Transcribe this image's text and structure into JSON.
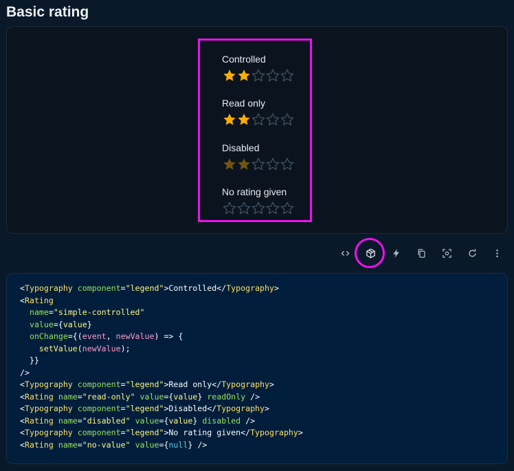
{
  "page": {
    "title": "Basic rating"
  },
  "ratings": [
    {
      "legend": "Controlled",
      "value": 2,
      "max": 5,
      "state": "active"
    },
    {
      "legend": "Read only",
      "value": 2,
      "max": 5,
      "state": "active"
    },
    {
      "legend": "Disabled",
      "value": 2,
      "max": 5,
      "state": "disabled"
    },
    {
      "legend": "No rating given",
      "value": 0,
      "max": 5,
      "state": "active"
    }
  ],
  "toolbar": {
    "buttons": [
      {
        "name": "code-icon",
        "label": "Show code"
      },
      {
        "name": "codesandbox-icon",
        "label": "Edit in CodeSandbox"
      },
      {
        "name": "stackblitz-icon",
        "label": "Edit in StackBlitz"
      },
      {
        "name": "copy-icon",
        "label": "Copy the source"
      },
      {
        "name": "focus-icon",
        "label": "Reset focus"
      },
      {
        "name": "refresh-icon",
        "label": "Reset demo"
      },
      {
        "name": "more-icon",
        "label": "See more"
      }
    ]
  },
  "code": {
    "lines": [
      [
        [
          "p",
          "<"
        ],
        [
          "tag",
          "Typography"
        ],
        [
          "p",
          " "
        ],
        [
          "attr",
          "component"
        ],
        [
          "p",
          "="
        ],
        [
          "str",
          "\"legend\""
        ],
        [
          "p",
          ">Controlled</"
        ],
        [
          "tag",
          "Typography"
        ],
        [
          "p",
          ">"
        ]
      ],
      [
        [
          "p",
          "<"
        ],
        [
          "tag",
          "Rating"
        ]
      ],
      [
        [
          "p",
          "  "
        ],
        [
          "attr",
          "name"
        ],
        [
          "p",
          "="
        ],
        [
          "str",
          "\"simple-controlled\""
        ]
      ],
      [
        [
          "p",
          "  "
        ],
        [
          "attr",
          "value"
        ],
        [
          "p",
          "={"
        ],
        [
          "str",
          "value"
        ],
        [
          "p",
          "}"
        ]
      ],
      [
        [
          "p",
          "  "
        ],
        [
          "attr",
          "onChange"
        ],
        [
          "p",
          "={("
        ],
        [
          "var",
          "event"
        ],
        [
          "p",
          ", "
        ],
        [
          "var",
          "newValue"
        ],
        [
          "p",
          ") => {"
        ]
      ],
      [
        [
          "p",
          "    "
        ],
        [
          "str",
          "setValue"
        ],
        [
          "p",
          "("
        ],
        [
          "var",
          "newValue"
        ],
        [
          "p",
          ");"
        ]
      ],
      [
        [
          "p",
          "  }}"
        ]
      ],
      [
        [
          "p",
          "/>"
        ]
      ],
      [
        [
          "p",
          "<"
        ],
        [
          "tag",
          "Typography"
        ],
        [
          "p",
          " "
        ],
        [
          "attr",
          "component"
        ],
        [
          "p",
          "="
        ],
        [
          "str",
          "\"legend\""
        ],
        [
          "p",
          ">Read only</"
        ],
        [
          "tag",
          "Typography"
        ],
        [
          "p",
          ">"
        ]
      ],
      [
        [
          "p",
          "<"
        ],
        [
          "tag",
          "Rating"
        ],
        [
          "p",
          " "
        ],
        [
          "attr",
          "name"
        ],
        [
          "p",
          "="
        ],
        [
          "str",
          "\"read-only\""
        ],
        [
          "p",
          " "
        ],
        [
          "attr",
          "value"
        ],
        [
          "p",
          "={"
        ],
        [
          "str",
          "value"
        ],
        [
          "p",
          "} "
        ],
        [
          "attr",
          "readOnly"
        ],
        [
          "p",
          " />"
        ]
      ],
      [
        [
          "p",
          "<"
        ],
        [
          "tag",
          "Typography"
        ],
        [
          "p",
          " "
        ],
        [
          "attr",
          "component"
        ],
        [
          "p",
          "="
        ],
        [
          "str",
          "\"legend\""
        ],
        [
          "p",
          ">Disabled</"
        ],
        [
          "tag",
          "Typography"
        ],
        [
          "p",
          ">"
        ]
      ],
      [
        [
          "p",
          "<"
        ],
        [
          "tag",
          "Rating"
        ],
        [
          "p",
          " "
        ],
        [
          "attr",
          "name"
        ],
        [
          "p",
          "="
        ],
        [
          "str",
          "\"disabled\""
        ],
        [
          "p",
          " "
        ],
        [
          "attr",
          "value"
        ],
        [
          "p",
          "={"
        ],
        [
          "str",
          "value"
        ],
        [
          "p",
          "} "
        ],
        [
          "attr",
          "disabled"
        ],
        [
          "p",
          " />"
        ]
      ],
      [
        [
          "p",
          "<"
        ],
        [
          "tag",
          "Typography"
        ],
        [
          "p",
          " "
        ],
        [
          "attr",
          "component"
        ],
        [
          "p",
          "="
        ],
        [
          "str",
          "\"legend\""
        ],
        [
          "p",
          ">No rating given</"
        ],
        [
          "tag",
          "Typography"
        ],
        [
          "p",
          ">"
        ]
      ],
      [
        [
          "p",
          "<"
        ],
        [
          "tag",
          "Rating"
        ],
        [
          "p",
          " "
        ],
        [
          "attr",
          "name"
        ],
        [
          "p",
          "="
        ],
        [
          "str",
          "\"no-value\""
        ],
        [
          "p",
          " "
        ],
        [
          "attr",
          "value"
        ],
        [
          "p",
          "={"
        ],
        [
          "kw",
          "null"
        ],
        [
          "p",
          "} />"
        ]
      ]
    ]
  },
  "colors": {
    "star_filled": "#faaf00",
    "star_disabled": "#705612",
    "star_empty": "#3e5060",
    "highlight": "#ee11ee"
  }
}
